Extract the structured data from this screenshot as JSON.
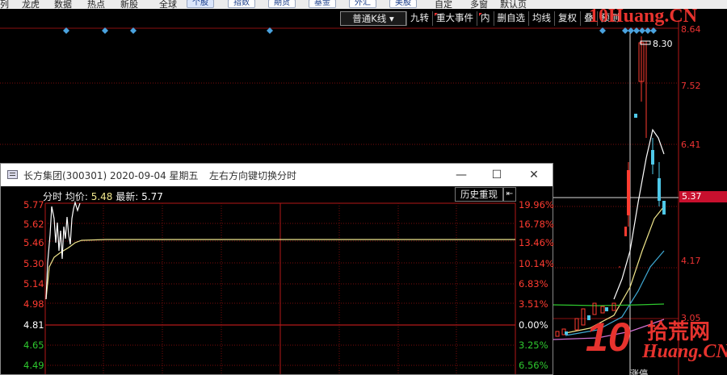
{
  "topbar": {
    "items": [
      "列",
      "龙虎",
      "数据",
      "热点",
      "新股",
      "全球"
    ],
    "buttons": [
      "个股",
      "指数",
      "期货",
      "基金",
      "外汇",
      "美股"
    ],
    "right_items": [
      "自定",
      "多窗",
      "默认页"
    ]
  },
  "kline": {
    "toolbar": {
      "dropdown": "普通K线",
      "items": [
        "九转",
        "重大事件",
        "内",
        "删自选",
        "均线",
        "复权",
        "叠",
        "预测"
      ]
    },
    "watermark": "10Huang.CN",
    "price_axis": [
      "8.64",
      "7.52",
      "6.41",
      "4.17",
      "3.05"
    ],
    "current_price": "5.37",
    "high_label": "8.30",
    "limit_up_label": "涨停"
  },
  "logo": {
    "number": "10",
    "chinese": "拾荒网",
    "english": "Huang.CN"
  },
  "intraday_window": {
    "title": "长方集团(300301) 2020-09-04 星期五",
    "hint": "左右方向键切换分时",
    "controls": {
      "minimize": "—",
      "maximize": "☐",
      "close": "✕"
    },
    "info": {
      "label_time": "分时",
      "label_avg": "均价:",
      "avg_value": "5.48",
      "label_latest": "最新:",
      "latest_value": "5.77"
    },
    "history_button": "历史重现",
    "arrow_button": "⇤",
    "left_axis": [
      {
        "v": "5.77",
        "c": "red"
      },
      {
        "v": "5.62",
        "c": "red"
      },
      {
        "v": "5.46",
        "c": "red"
      },
      {
        "v": "5.30",
        "c": "red"
      },
      {
        "v": "5.14",
        "c": "red"
      },
      {
        "v": "4.98",
        "c": "red"
      },
      {
        "v": "4.81",
        "c": "white"
      },
      {
        "v": "4.65",
        "c": "green"
      },
      {
        "v": "4.49",
        "c": "green"
      }
    ],
    "right_axis": [
      {
        "v": "19.96%",
        "c": "red"
      },
      {
        "v": "16.78%",
        "c": "red"
      },
      {
        "v": "13.46%",
        "c": "red"
      },
      {
        "v": "10.14%",
        "c": "red"
      },
      {
        "v": "6.83%",
        "c": "red"
      },
      {
        "v": "3.51%",
        "c": "red"
      },
      {
        "v": "0.00%",
        "c": "white"
      },
      {
        "v": "3.25%",
        "c": "green"
      },
      {
        "v": "6.56%",
        "c": "green"
      }
    ]
  },
  "colors": {
    "rise": "#ff3b30",
    "fall": "#2ec82e",
    "accent": "#e7332e",
    "avg_line": "#f0e68c"
  }
}
